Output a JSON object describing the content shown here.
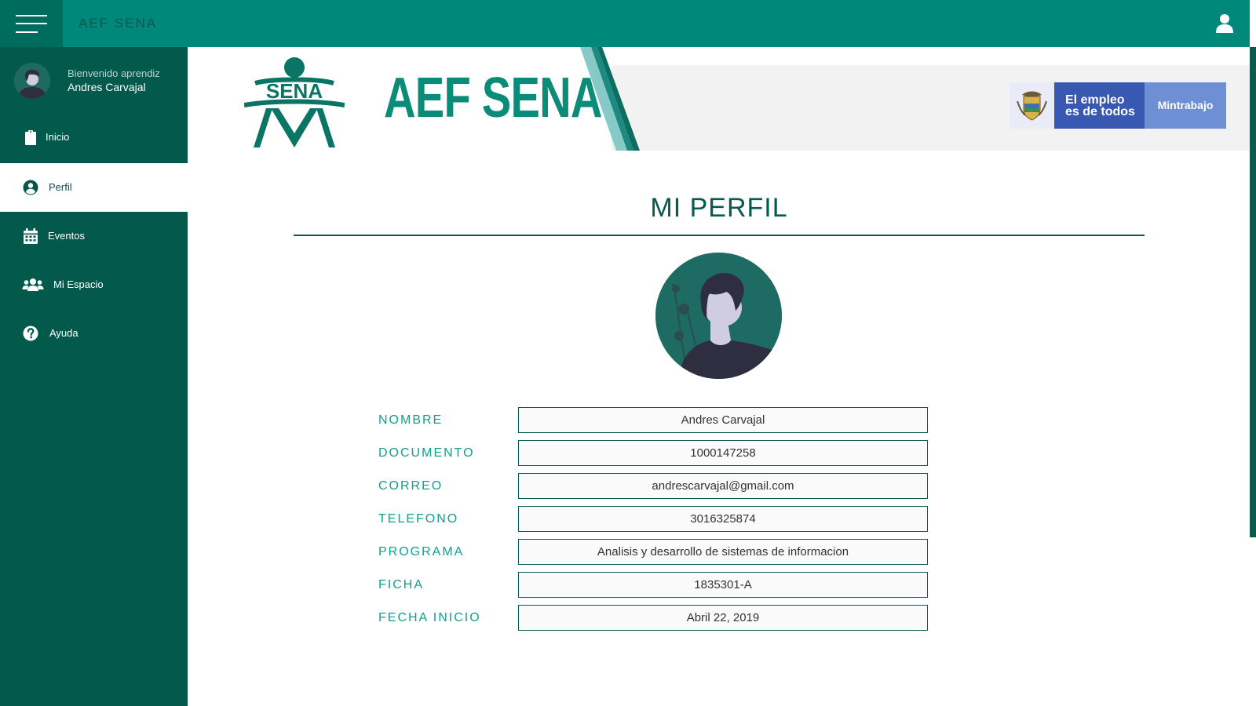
{
  "app": {
    "title": "AEF SENA"
  },
  "sidebar": {
    "greeting": "Bienvenido aprendiz",
    "user_name": "Andres Carvajal",
    "items": [
      {
        "label": "Inicio",
        "icon": "clipboard-icon"
      },
      {
        "label": "Perfil",
        "icon": "user-circle-icon",
        "active": true
      },
      {
        "label": "Eventos",
        "icon": "calendar-icon"
      },
      {
        "label": "Mi Espacio",
        "icon": "users-icon"
      },
      {
        "label": "Ayuda",
        "icon": "question-circle-icon"
      }
    ]
  },
  "banner": {
    "logo_text": "SENA",
    "title": "AEF SENA",
    "gov_slogan": "El empleo\nes de todos",
    "gov_ministry": "Mintrabajo"
  },
  "profile": {
    "title": "MI PERFIL",
    "fields": [
      {
        "label": "NOMBRE",
        "value": "Andres Carvajal"
      },
      {
        "label": "DOCUMENTO",
        "value": "1000147258"
      },
      {
        "label": "CORREO",
        "value": "andrescarvajal@gmail.com"
      },
      {
        "label": "TELEFONO",
        "value": "3016325874"
      },
      {
        "label": "PROGRAMA",
        "value": "Analisis y desarrollo de sistemas de informacion"
      },
      {
        "label": "FICHA",
        "value": "1835301-A"
      },
      {
        "label": "FECHA INICIO",
        "value": "Abril 22, 2019"
      }
    ]
  },
  "colors": {
    "topbar": "#00897b",
    "sidebar": "#035a4c",
    "accent": "#10a08c",
    "title": "#065a4e",
    "gov_blue": "#3858b2"
  }
}
